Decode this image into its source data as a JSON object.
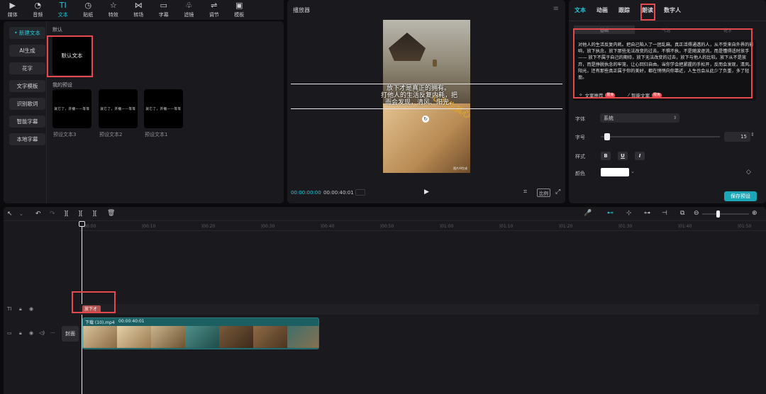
{
  "toolbar": {
    "items": [
      {
        "label": "媒体",
        "icon": "media-icon"
      },
      {
        "label": "音频",
        "icon": "audio-icon"
      },
      {
        "label": "文本",
        "icon": "text-icon",
        "active": true
      },
      {
        "label": "贴纸",
        "icon": "sticker-icon"
      },
      {
        "label": "特效",
        "icon": "effects-icon"
      },
      {
        "label": "转场",
        "icon": "transition-icon"
      },
      {
        "label": "字幕",
        "icon": "subtitle-icon"
      },
      {
        "label": "滤镜",
        "icon": "filter-icon"
      },
      {
        "label": "调节",
        "icon": "adjust-icon"
      },
      {
        "label": "模板",
        "icon": "template-icon"
      }
    ]
  },
  "library": {
    "categories": [
      "• 新建文本",
      "AI生成",
      "花字",
      "文字模板",
      "识别歌词",
      "智能字幕",
      "本地字幕"
    ],
    "default_section": "默认",
    "default_tile": "默认文本",
    "presets_section": "我的预设",
    "preset_tile_text": "就它了，开播——等等",
    "presets": [
      "预设文本3",
      "预设文本2",
      "预设文本1"
    ]
  },
  "player": {
    "title": "播放器",
    "subtitle_lines": [
      "放下才是真正的拥有。",
      "打他人的生活反复内耗，把",
      "而会发现，清风、阳光，"
    ],
    "gold_text": "心而生其心",
    "watermark": "图片AI生成",
    "current_time": "00:00:00:00",
    "total_time": "00:00:40:01",
    "ratio_label": "比例"
  },
  "inspector": {
    "tabs": [
      "文本",
      "动画",
      "跟踪",
      "朗读",
      "数字人"
    ],
    "segments": [
      "基础",
      "气泡",
      "花字"
    ],
    "body_text": "对他人的生活反复内耗。把自己陷入了一团乱麻。真正活得通透的人，从不受来自外界的影响，放下执念，放下那些无法改变的过去。不惧不执，不是随波逐流，而是懂得适时放手 —— 放下不属于自己的期待，放下无法改变的过去，放下与他人的比较。放下从不是放弃，而是挣脱执念的牢笼，让心回归自由。当你学会把紧握的手松开，反而会发现，清风、阳光，还有那些真正属于你的美好，都在悄悄向你靠近，人生也会从此少了负重，多了轻盈。",
    "ai_recommend": "文案推荐",
    "ai_badge": "限免",
    "smart_copy": "智能文案",
    "font_label": "字体",
    "font_value": "系统",
    "size_label": "字号",
    "size_value": "15",
    "size_slider": 0.03,
    "style_label": "样式",
    "style_bold": "B",
    "style_underline": "U",
    "style_italic": "I",
    "color_label": "颜色",
    "color_value": "#ffffff",
    "save_preset": "保存预设"
  },
  "timeline": {
    "ruler": [
      "00:00",
      "00:10",
      "00:20",
      "00:30",
      "00:40",
      "00:50",
      "01:00",
      "01:10",
      "01:20",
      "01:30",
      "01:40",
      "01:50"
    ],
    "text_clip": "放下才",
    "video_clip_name": "下载 (10).mp4",
    "video_clip_duration": "00:00:40:01",
    "cover_label": "封面",
    "zoom_level": 0.3
  },
  "colors": {
    "accent": "#26c6da",
    "highlight": "#e5484d",
    "clip": "#1c5f63"
  }
}
